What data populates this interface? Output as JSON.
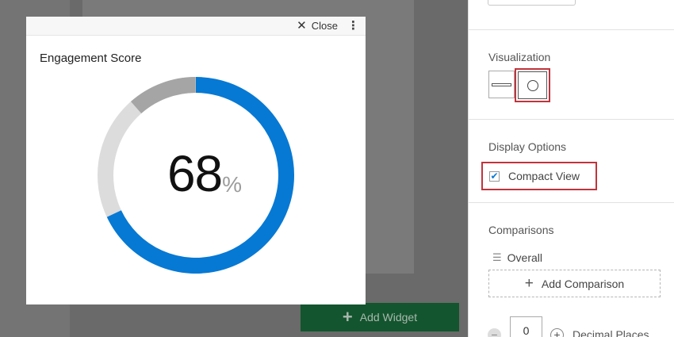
{
  "background": {
    "add_widget_label": "Add Widget"
  },
  "widget": {
    "close_label": "Close",
    "title": "Engagement Score",
    "score": "68",
    "unit": "%",
    "progress_fraction": 0.68,
    "colors": {
      "progress": "#0679d4",
      "track": "#dcdcdc",
      "accent": "#a5a5a5"
    }
  },
  "panel": {
    "visualization_title": "Visualization",
    "display_options_title": "Display Options",
    "compact_view_label": "Compact View",
    "compact_view_checked": true,
    "comparisons_title": "Comparisons",
    "overall_label": "Overall",
    "add_comparison_label": "Add Comparison",
    "decimal_places_value": "0",
    "decimal_places_label": "Decimal Places",
    "highlight_color": "#c0343c"
  }
}
